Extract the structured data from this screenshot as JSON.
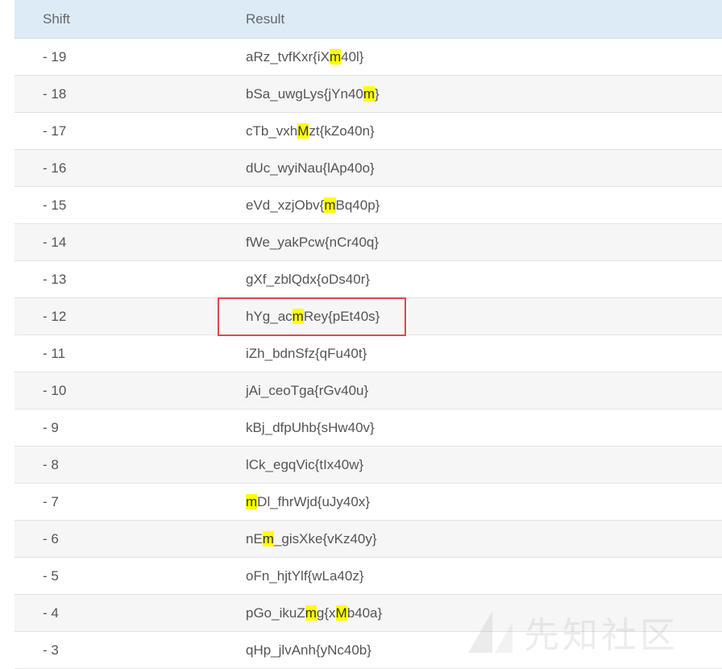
{
  "table": {
    "headers": {
      "shift": "Shift",
      "result": "Result"
    },
    "rows": [
      {
        "shift": "- 19",
        "segments": [
          [
            "aRz_tvfKxr{iX",
            false
          ],
          [
            "m",
            true
          ],
          [
            "40l}",
            false
          ]
        ]
      },
      {
        "shift": "- 18",
        "segments": [
          [
            "bSa_uwgLys{jYn40",
            false
          ],
          [
            "m",
            true
          ],
          [
            "}",
            false
          ]
        ]
      },
      {
        "shift": "- 17",
        "segments": [
          [
            "cTb_vxh",
            false
          ],
          [
            "M",
            true
          ],
          [
            "zt{kZo40n}",
            false
          ]
        ]
      },
      {
        "shift": "- 16",
        "segments": [
          [
            "dUc_wyiNau{lAp40o}",
            false
          ]
        ]
      },
      {
        "shift": "- 15",
        "segments": [
          [
            "eVd_xzjObv{",
            false
          ],
          [
            "m",
            true
          ],
          [
            "Bq40p}",
            false
          ]
        ]
      },
      {
        "shift": "- 14",
        "segments": [
          [
            "fWe_yakPcw{nCr40q}",
            false
          ]
        ]
      },
      {
        "shift": "- 13",
        "segments": [
          [
            "gXf_zblQdx{oDs40r}",
            false
          ]
        ]
      },
      {
        "shift": "- 12",
        "segments": [
          [
            "hYg_ac",
            false
          ],
          [
            "m",
            true
          ],
          [
            "Rey{pEt40s}",
            false
          ]
        ]
      },
      {
        "shift": "- 11",
        "segments": [
          [
            "iZh_bdnSfz{qFu40t}",
            false
          ]
        ]
      },
      {
        "shift": "- 10",
        "segments": [
          [
            "jAi_ceoTga{rGv40u}",
            false
          ]
        ]
      },
      {
        "shift": "- 9",
        "segments": [
          [
            "kBj_dfpUhb{sHw40v}",
            false
          ]
        ]
      },
      {
        "shift": "- 8",
        "segments": [
          [
            "lCk_egqVic{tIx40w}",
            false
          ]
        ]
      },
      {
        "shift": "- 7",
        "segments": [
          [
            "m",
            true
          ],
          [
            "Dl_fhrWjd{uJy40x}",
            false
          ]
        ]
      },
      {
        "shift": "- 6",
        "segments": [
          [
            "nE",
            false
          ],
          [
            "m",
            true
          ],
          [
            "_gisXke{vKz40y}",
            false
          ]
        ]
      },
      {
        "shift": "- 5",
        "segments": [
          [
            "oFn_hjtYlf{wLa40z}",
            false
          ]
        ]
      },
      {
        "shift": "- 4",
        "segments": [
          [
            "pGo_ikuZ",
            false
          ],
          [
            "m",
            true
          ],
          [
            "g{x",
            false
          ],
          [
            "M",
            true
          ],
          [
            "b40a}",
            false
          ]
        ]
      },
      {
        "shift": "- 3",
        "segments": [
          [
            "qHp_jlvAnh{yNc40b}",
            false
          ]
        ]
      }
    ]
  },
  "highlight": {
    "color": "#ffff00",
    "outline_color": "#e0474c"
  },
  "watermark": {
    "text": "先知社区"
  }
}
